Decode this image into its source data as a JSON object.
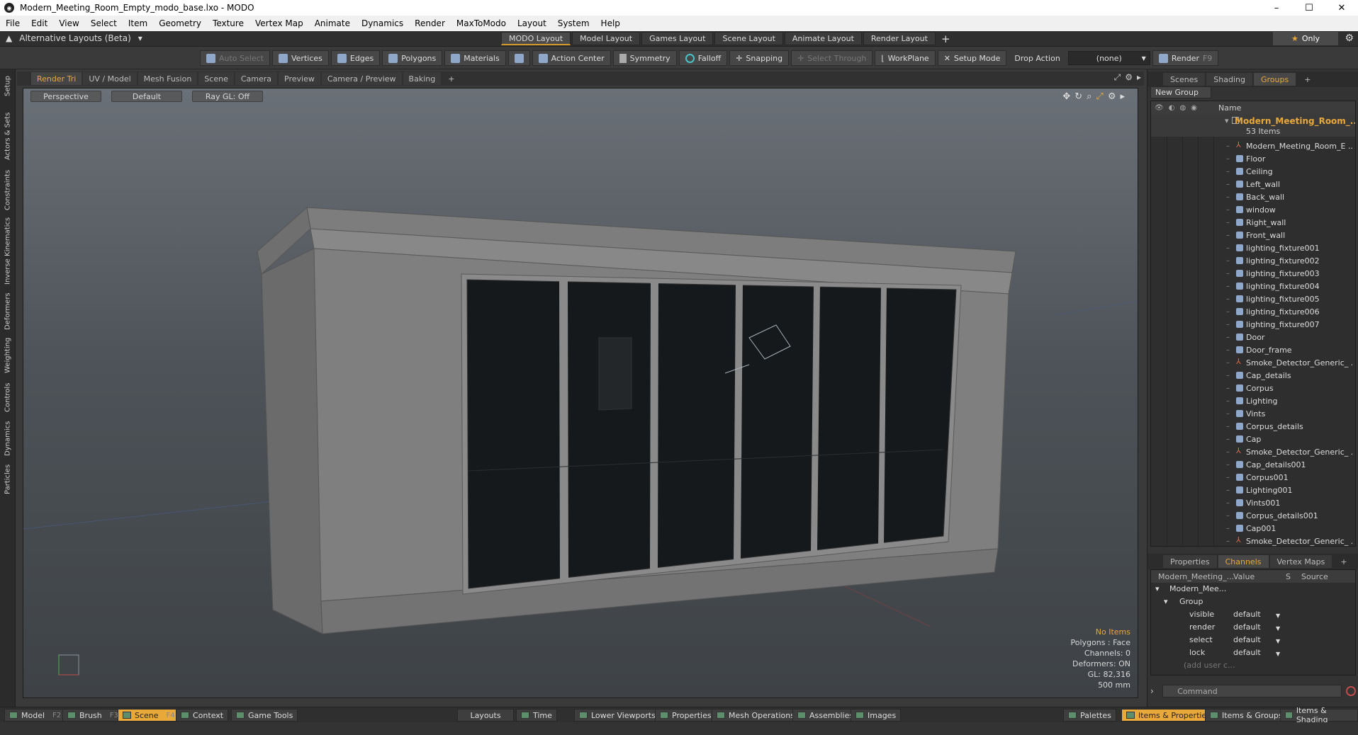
{
  "window": {
    "title": "Modern_Meeting_Room_Empty_modo_base.lxo - MODO",
    "app_icon": "modo-logo"
  },
  "menu": [
    "File",
    "Edit",
    "View",
    "Select",
    "Item",
    "Geometry",
    "Texture",
    "Vertex Map",
    "Animate",
    "Dynamics",
    "Render",
    "MaxToModo",
    "Layout",
    "System",
    "Help"
  ],
  "layoutbar": {
    "alt_layout": "Alternative Layouts (Beta)",
    "tabs": [
      "MODO Layout",
      "Model Layout",
      "Games Layout",
      "Scene Layout",
      "Animate Layout",
      "Render Layout"
    ],
    "active_tab": "MODO Layout",
    "only_label": "Only"
  },
  "toolbar": {
    "auto_select": "Auto Select",
    "vertices": "Vertices",
    "edges": "Edges",
    "polygons": "Polygons",
    "materials": "Materials",
    "action_center": "Action Center",
    "symmetry": "Symmetry",
    "falloff": "Falloff",
    "snapping": "Snapping",
    "select_through": "Select Through",
    "workplane": "WorkPlane",
    "setup_mode": "Setup Mode",
    "drop_action_label": "Drop Action",
    "drop_action_value": "(none)",
    "render": "Render",
    "render_key": "F9"
  },
  "left_tabs": [
    "Setup",
    "Actors & Sets",
    "Constraints",
    "Inverse Kinematics",
    "Deformers",
    "Weighting",
    "Controls",
    "Dynamics",
    "Particles"
  ],
  "viewport_tabs": [
    "Render Tri",
    "UV / Model",
    "Mesh Fusion",
    "Scene",
    "Camera",
    "Preview",
    "Camera / Preview",
    "Baking"
  ],
  "viewport_active_tab": "Render Tri",
  "viewport": {
    "view": "Perspective",
    "shading": "Default",
    "raygl": "Ray GL: Off",
    "stats": {
      "no_items": "No Items",
      "polygons": "Polygons : Face",
      "channels": "Channels: 0",
      "deformers": "Deformers: ON",
      "gl": "GL: 82,316",
      "scale": "500 mm"
    }
  },
  "right_panel": {
    "tabs": [
      "Scenes",
      "Shading",
      "Groups"
    ],
    "active_tab": "Groups",
    "new_group": "New Group",
    "outliner_header": "Name",
    "root": {
      "name": "Modern_Meeting_Room_...",
      "count": "53 Items"
    },
    "items": [
      {
        "name": "Modern_Meeting_Room_E ...",
        "type": "locator"
      },
      {
        "name": "Floor",
        "type": "mesh"
      },
      {
        "name": "Ceiling",
        "type": "mesh"
      },
      {
        "name": "Left_wall",
        "type": "mesh"
      },
      {
        "name": "Back_wall",
        "type": "mesh"
      },
      {
        "name": "window",
        "type": "mesh"
      },
      {
        "name": "Right_wall",
        "type": "mesh"
      },
      {
        "name": "Front_wall",
        "type": "mesh"
      },
      {
        "name": "lighting_fixture001",
        "type": "mesh"
      },
      {
        "name": "lighting_fixture002",
        "type": "mesh"
      },
      {
        "name": "lighting_fixture003",
        "type": "mesh"
      },
      {
        "name": "lighting_fixture004",
        "type": "mesh"
      },
      {
        "name": "lighting_fixture005",
        "type": "mesh"
      },
      {
        "name": "lighting_fixture006",
        "type": "mesh"
      },
      {
        "name": "lighting_fixture007",
        "type": "mesh"
      },
      {
        "name": "Door",
        "type": "mesh"
      },
      {
        "name": "Door_frame",
        "type": "mesh"
      },
      {
        "name": "Smoke_Detector_Generic_ ...",
        "type": "locator"
      },
      {
        "name": "Cap_details",
        "type": "mesh"
      },
      {
        "name": "Corpus",
        "type": "mesh"
      },
      {
        "name": "Lighting",
        "type": "mesh"
      },
      {
        "name": "Vints",
        "type": "mesh"
      },
      {
        "name": "Corpus_details",
        "type": "mesh"
      },
      {
        "name": "Cap",
        "type": "mesh"
      },
      {
        "name": "Smoke_Detector_Generic_ ...",
        "type": "locator"
      },
      {
        "name": "Cap_details001",
        "type": "mesh"
      },
      {
        "name": "Corpus001",
        "type": "mesh"
      },
      {
        "name": "Lighting001",
        "type": "mesh"
      },
      {
        "name": "Vints001",
        "type": "mesh"
      },
      {
        "name": "Corpus_details001",
        "type": "mesh"
      },
      {
        "name": "Cap001",
        "type": "mesh"
      },
      {
        "name": "Smoke_Detector_Generic_ ...",
        "type": "locator"
      }
    ],
    "lower_tabs": [
      "Properties",
      "Channels",
      "Vertex Maps"
    ],
    "lower_active": "Channels",
    "channels": {
      "headers": [
        "Modern_Meeting_...",
        "Value",
        "S",
        "Source"
      ],
      "root": "Modern_Mee...",
      "group": "Group",
      "rows": [
        {
          "name": "visible",
          "value": "default"
        },
        {
          "name": "render",
          "value": "default"
        },
        {
          "name": "select",
          "value": "default"
        },
        {
          "name": "lock",
          "value": "default"
        }
      ],
      "add_user": "(add user c..."
    },
    "command_placeholder": "Command"
  },
  "bottombar": {
    "left": [
      {
        "label": "Model",
        "key": "F2"
      },
      {
        "label": "Brush",
        "key": "F3"
      },
      {
        "label": "Scene",
        "key": "F4"
      },
      {
        "label": "Context",
        "key": ""
      },
      {
        "label": "Game Tools",
        "key": ""
      }
    ],
    "active": "Scene",
    "center": [
      "Layouts",
      "Time",
      "Lower Viewports",
      "Properties",
      "Mesh Operations",
      "Assemblies",
      "Images"
    ],
    "right": [
      "Palettes",
      "Items & Properties",
      "Items & Groups",
      "Items & Shading"
    ],
    "right_active": "Items & Properties"
  },
  "colors": {
    "accent": "#e8a93a",
    "panel": "#333333",
    "viewport_top": "#6a7077"
  }
}
